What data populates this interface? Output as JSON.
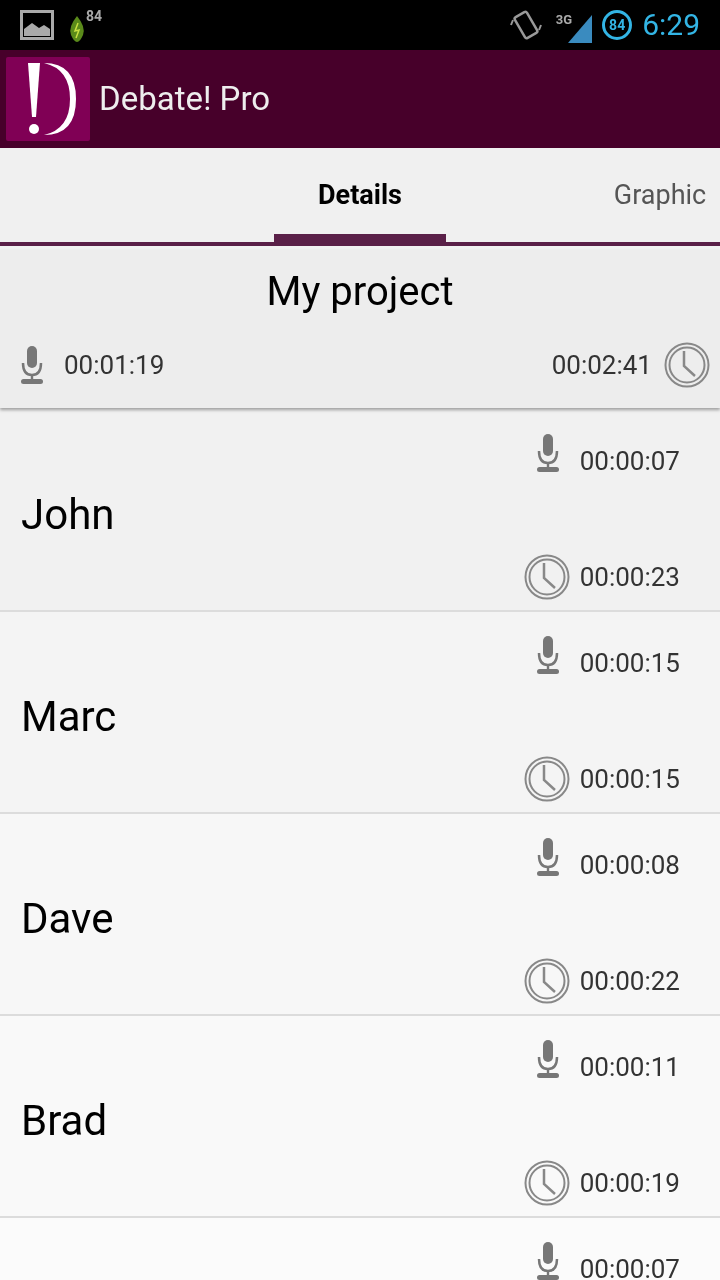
{
  "status_bar": {
    "leaf_badge": "84",
    "network": "3G",
    "battery": "84",
    "time": "6:29"
  },
  "app_bar": {
    "title": "Debate! Pro"
  },
  "tabs": [
    {
      "label": "Details",
      "selected": true
    },
    {
      "label": "Graphic",
      "selected": false
    }
  ],
  "project": {
    "title": "My project",
    "speaking_time": "00:01:19",
    "total_time": "00:02:41"
  },
  "speakers": [
    {
      "name": "John",
      "speaking_time": "00:00:07",
      "total_time": "00:00:23"
    },
    {
      "name": "Marc",
      "speaking_time": "00:00:15",
      "total_time": "00:00:15"
    },
    {
      "name": "Dave",
      "speaking_time": "00:00:08",
      "total_time": "00:00:22"
    },
    {
      "name": "Brad",
      "speaking_time": "00:00:11",
      "total_time": "00:00:19"
    },
    {
      "speaking_time": "00:00:07"
    }
  ]
}
